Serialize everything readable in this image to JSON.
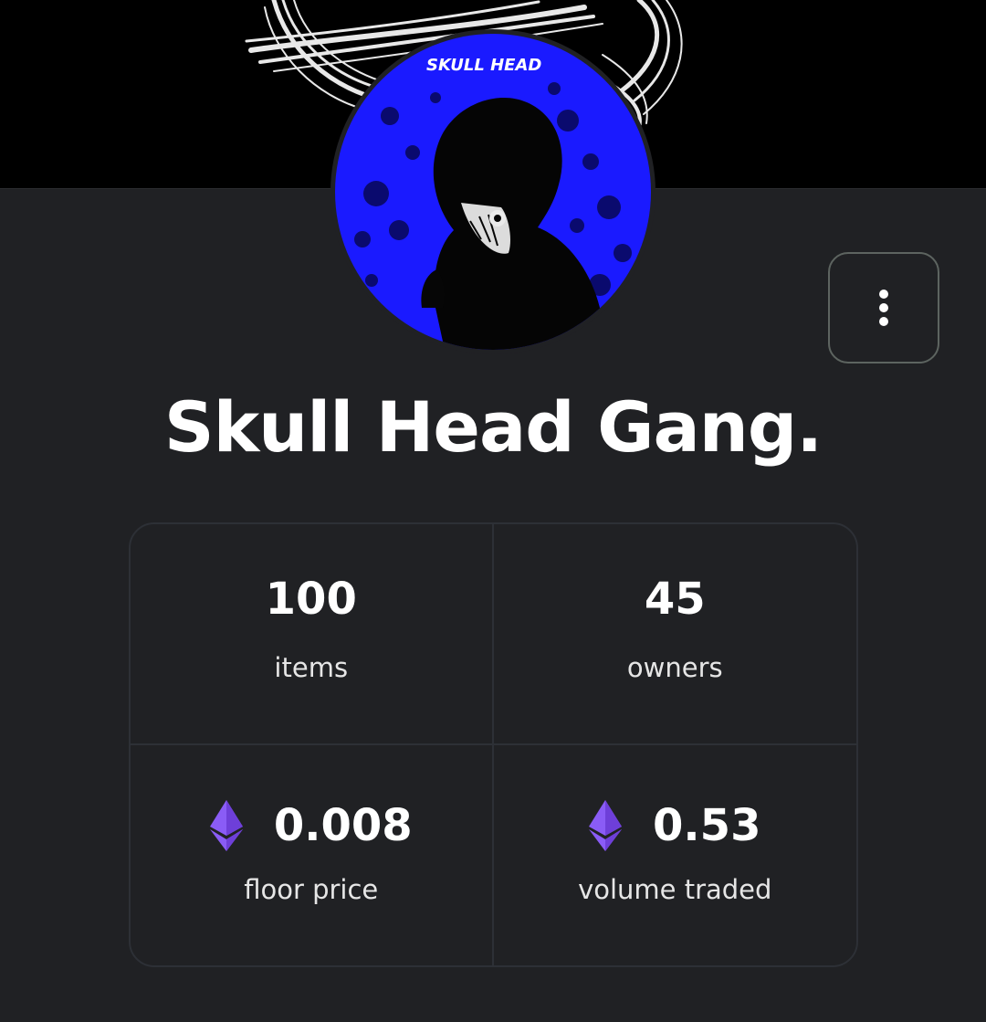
{
  "collection": {
    "name": "Skull Head Gang.",
    "avatar_caption": "SKULL HEAD"
  },
  "actions": {
    "more_icon": "more-vertical-icon"
  },
  "stats": {
    "items": {
      "value": "100",
      "label": "items"
    },
    "owners": {
      "value": "45",
      "label": "owners"
    },
    "floor_price": {
      "value": "0.008",
      "label": "floor price",
      "currency_icon": "ethereum-icon"
    },
    "volume_traded": {
      "value": "0.53",
      "label": "volume traded",
      "currency_icon": "ethereum-icon"
    }
  },
  "colors": {
    "background": "#202124",
    "banner": "#000000",
    "avatar_blue": "#1a1aff",
    "eth_purple": "#8a5cf6",
    "border": "#2d3036"
  }
}
